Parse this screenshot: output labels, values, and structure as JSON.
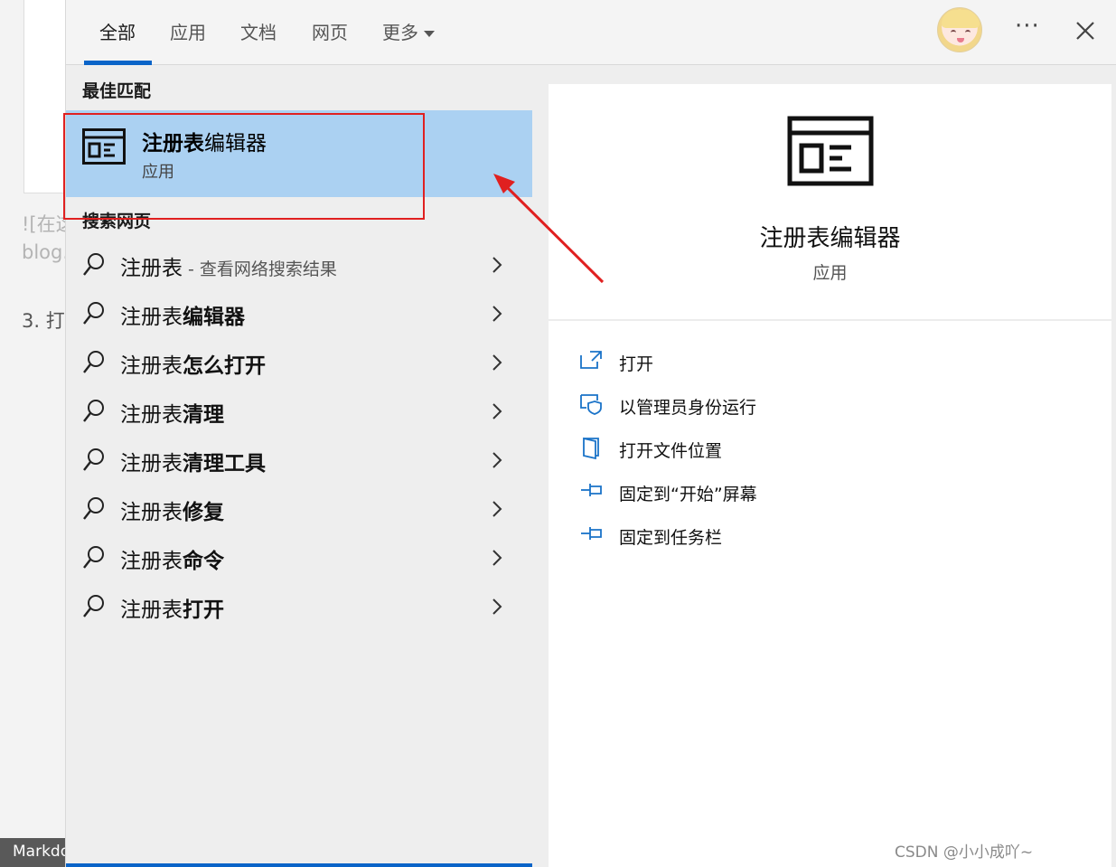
{
  "background_editor": {
    "snippet_line_1": "![在这",
    "snippet_line_2": "blog.",
    "snippet_line_3": "3. 打",
    "markdown_tag": "Markdo"
  },
  "tabs": [
    {
      "label": "全部",
      "active": true
    },
    {
      "label": "应用",
      "active": false
    },
    {
      "label": "文档",
      "active": false
    },
    {
      "label": "网页",
      "active": false
    },
    {
      "label": "更多",
      "active": false
    }
  ],
  "toolbar": {
    "more_options_label": "···"
  },
  "best_match": {
    "section_title": "最佳匹配",
    "title_bold": "注册表",
    "title_rest": "编辑器",
    "subtitle": "应用"
  },
  "web_search": {
    "section_title": "搜索网页",
    "items": [
      {
        "prefix": "注册表",
        "bold": "",
        "suffix": " - 查看网络搜索结果"
      },
      {
        "prefix": "注册表",
        "bold": "编辑器",
        "suffix": ""
      },
      {
        "prefix": "注册表",
        "bold": "怎么打开",
        "suffix": ""
      },
      {
        "prefix": "注册表",
        "bold": "清理",
        "suffix": ""
      },
      {
        "prefix": "注册表",
        "bold": "清理工具",
        "suffix": ""
      },
      {
        "prefix": "注册表",
        "bold": "修复",
        "suffix": ""
      },
      {
        "prefix": "注册表",
        "bold": "命令",
        "suffix": ""
      },
      {
        "prefix": "注册表",
        "bold": "打开",
        "suffix": ""
      }
    ]
  },
  "detail": {
    "app_name": "注册表编辑器",
    "app_type": "应用",
    "actions": [
      {
        "label": "打开",
        "icon": "open-icon"
      },
      {
        "label": "以管理员身份运行",
        "icon": "shield-admin-icon"
      },
      {
        "label": "打开文件位置",
        "icon": "file-location-icon"
      },
      {
        "label": "固定到“开始”屏幕",
        "icon": "pin-icon"
      },
      {
        "label": "固定到任务栏",
        "icon": "pin-icon"
      }
    ]
  },
  "watermark": "CSDN @小小成吖~",
  "colors": {
    "accent": "#0a64c8",
    "selected_bg": "#abd1f2",
    "annotation_red": "#e02020",
    "action_icon": "#1a73c8"
  }
}
